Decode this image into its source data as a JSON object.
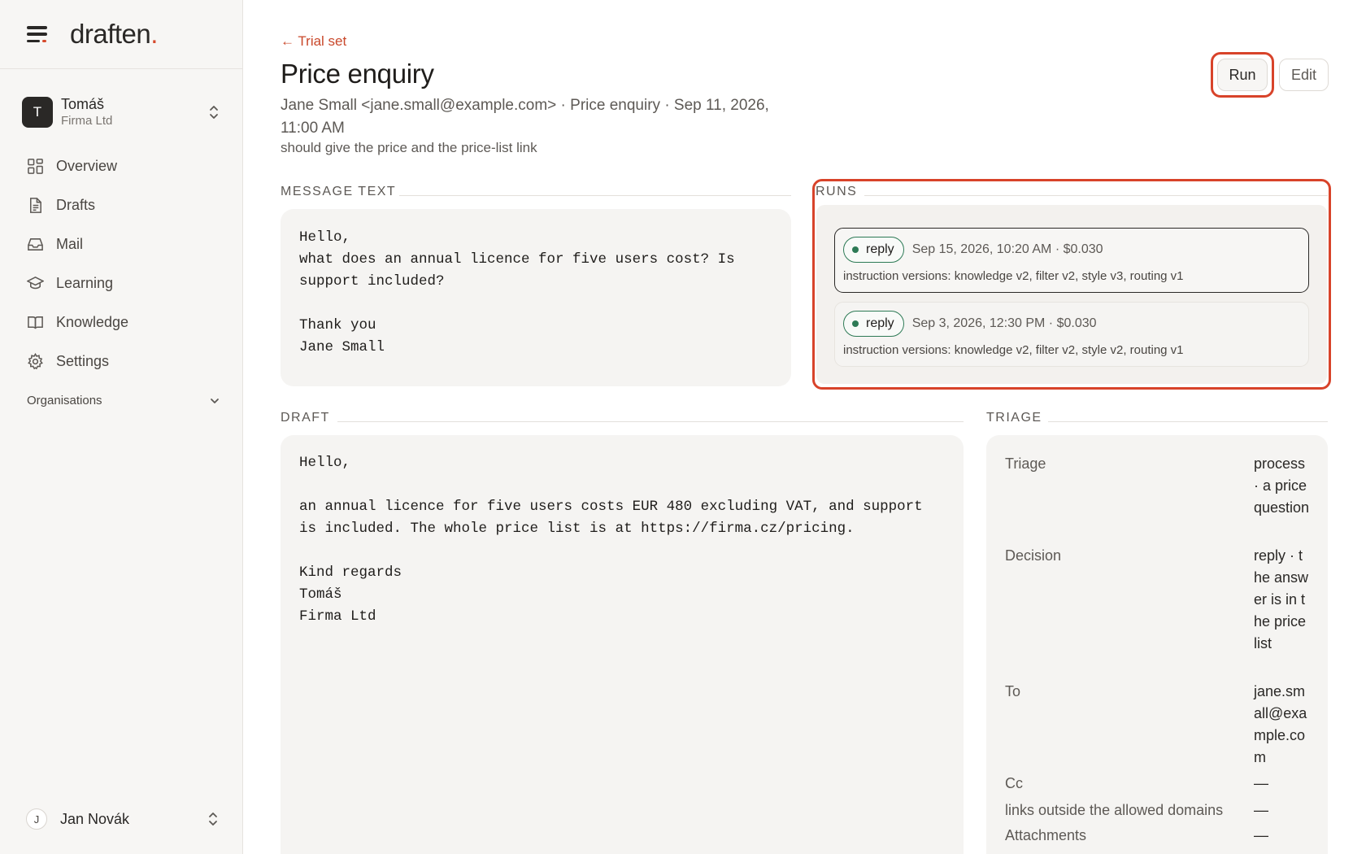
{
  "app": {
    "logo_text": "draften",
    "logo_dot": "."
  },
  "org": {
    "avatar": "T",
    "name": "Tomáš",
    "subtitle": "Firma Ltd"
  },
  "nav": {
    "items": [
      {
        "label": "Overview",
        "icon": "grid-icon"
      },
      {
        "label": "Drafts",
        "icon": "document-icon"
      },
      {
        "label": "Mail",
        "icon": "inbox-icon"
      },
      {
        "label": "Learning",
        "icon": "graduation-cap-icon"
      },
      {
        "label": "Knowledge",
        "icon": "book-icon"
      },
      {
        "label": "Settings",
        "icon": "gear-icon"
      }
    ],
    "organisations_label": "Organisations"
  },
  "user": {
    "avatar": "J",
    "name": "Jan Novák"
  },
  "header": {
    "back_link": "← Trial set",
    "title": "Price enquiry",
    "meta": "Jane Small <jane.small@example.com> · Price enquiry · Sep 11, 2026, 11:00 AM",
    "note": "should give the price and the price-list link",
    "run_label": "Run",
    "edit_label": "Edit"
  },
  "message": {
    "label": "MESSAGE TEXT",
    "body": "Hello,\nwhat does an annual licence for five users cost? Is\nsupport included?\n\nThank you\nJane Small"
  },
  "runs": {
    "label": "RUNS",
    "items": [
      {
        "status": "reply",
        "when": "Sep 15, 2026, 10:20 AM · $0.030",
        "versions": "instruction versions: knowledge v2, filter v2, style v3, routing v1"
      },
      {
        "status": "reply",
        "when": "Sep 3, 2026, 12:30 PM · $0.030",
        "versions": "instruction versions: knowledge v2, filter v2, style v2, routing v1"
      }
    ]
  },
  "draft": {
    "label": "DRAFT",
    "body": "Hello,\n\nan annual licence for five users costs EUR 480 excluding VAT, and support\nis included. The whole price list is at https://firma.cz/pricing.\n\nKind regards\nTomáš\nFirma Ltd"
  },
  "triage": {
    "label": "TRIAGE",
    "rows": [
      {
        "key": "Triage",
        "value": "process · a price question"
      },
      {
        "key": "Decision",
        "value": "reply · the answer is in the price list"
      },
      {
        "key": "To",
        "value": "jane.small@example.com"
      },
      {
        "key": "Cc",
        "value": "—"
      },
      {
        "key": "links outside the allowed domains",
        "value": "—"
      },
      {
        "key": "Attachments",
        "value": "—"
      }
    ]
  },
  "colors": {
    "accent": "#d8432a",
    "status_green": "#2d7a55",
    "sidebar_bg": "#f7f6f4",
    "card_bg": "#f5f4f2"
  }
}
